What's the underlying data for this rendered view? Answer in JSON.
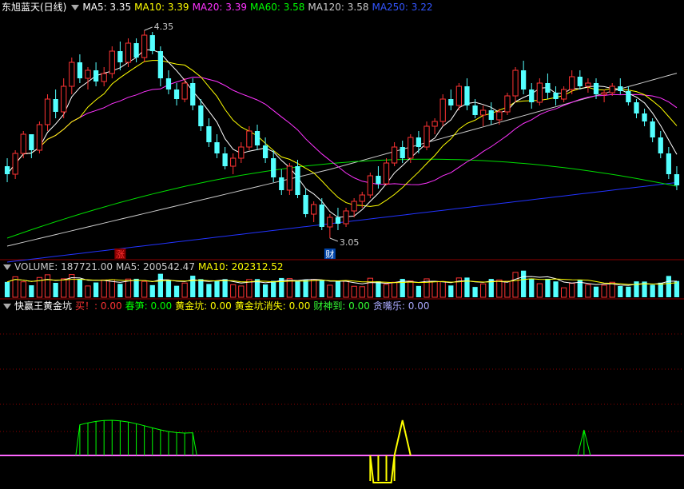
{
  "main_header": {
    "stock": "东旭蓝天(日线)",
    "ma_items": [
      {
        "label": "MA5: 3.35",
        "color": "#ffffff"
      },
      {
        "label": "MA10: 3.39",
        "color": "#ffff00"
      },
      {
        "label": "MA20: 3.39",
        "color": "#ff33ff"
      },
      {
        "label": "MA60: 3.58",
        "color": "#00ff00"
      },
      {
        "label": "MA120: 3.58",
        "color": "#cccccc"
      },
      {
        "label": "MA250: 3.22",
        "color": "#3355ff"
      }
    ]
  },
  "volume_header": {
    "items": [
      {
        "label": "VOLUME: 187721.00",
        "color": "#cccccc"
      },
      {
        "label": "MA5: 200542.47",
        "color": "#cccccc"
      },
      {
        "label": "MA10: 202312.52",
        "color": "#ffff00"
      }
    ]
  },
  "indicator_header": {
    "name": "快赢王黄金坑",
    "items": [
      {
        "label": "买！: 0.00",
        "color": "#ff3333"
      },
      {
        "label": "春笋: 0.00",
        "color": "#00ff00"
      },
      {
        "label": "黄金坑: 0.00",
        "color": "#ffff00"
      },
      {
        "label": "黄金坑消失: 0.00",
        "color": "#ffff00"
      },
      {
        "label": "财神到: 0.00",
        "color": "#33ff33"
      },
      {
        "label": "贪嘴乐: 0.00",
        "color": "#aaaaff"
      }
    ]
  },
  "markers": {
    "high": "4.35",
    "low": "3.05",
    "zhang": "涨",
    "cai": "财"
  },
  "colors": {
    "up": "#ff3333",
    "down": "#54ffff",
    "ma5": "#ffffff",
    "ma10": "#ffff00",
    "ma20": "#ff33ff",
    "ma60": "#00dd00",
    "ma120": "#cccccc",
    "ma250": "#2233ff",
    "grid": "#8b0000"
  },
  "chart_data": {
    "type": "candlestick",
    "ylim": [
      2.95,
      4.45
    ],
    "candles": [
      [
        3.5,
        3.55,
        3.4,
        3.45
      ],
      [
        3.45,
        3.6,
        3.42,
        3.58
      ],
      [
        3.58,
        3.72,
        3.55,
        3.7
      ],
      [
        3.7,
        3.7,
        3.55,
        3.6
      ],
      [
        3.6,
        3.78,
        3.58,
        3.76
      ],
      [
        3.76,
        3.95,
        3.72,
        3.92
      ],
      [
        3.92,
        3.98,
        3.8,
        3.84
      ],
      [
        3.84,
        4.05,
        3.8,
        4.0
      ],
      [
        4.0,
        4.18,
        3.95,
        4.15
      ],
      [
        4.15,
        4.2,
        4.02,
        4.05
      ],
      [
        4.05,
        4.12,
        3.98,
        4.1
      ],
      [
        4.1,
        4.15,
        4.0,
        4.03
      ],
      [
        4.03,
        4.12,
        4.0,
        4.08
      ],
      [
        4.08,
        4.25,
        4.05,
        4.22
      ],
      [
        4.22,
        4.28,
        4.1,
        4.15
      ],
      [
        4.15,
        4.3,
        4.12,
        4.27
      ],
      [
        4.27,
        4.3,
        4.15,
        4.18
      ],
      [
        4.18,
        4.35,
        4.15,
        4.32
      ],
      [
        4.32,
        4.34,
        4.2,
        4.22
      ],
      [
        4.22,
        4.25,
        4.0,
        4.05
      ],
      [
        4.05,
        4.1,
        3.95,
        3.98
      ],
      [
        3.98,
        4.02,
        3.88,
        3.92
      ],
      [
        3.92,
        4.05,
        3.9,
        4.02
      ],
      [
        4.02,
        4.05,
        3.85,
        3.88
      ],
      [
        3.88,
        3.92,
        3.72,
        3.75
      ],
      [
        3.75,
        3.8,
        3.62,
        3.65
      ],
      [
        3.65,
        3.7,
        3.55,
        3.58
      ],
      [
        3.58,
        3.62,
        3.48,
        3.5
      ],
      [
        3.5,
        3.58,
        3.45,
        3.55
      ],
      [
        3.55,
        3.65,
        3.52,
        3.62
      ],
      [
        3.62,
        3.75,
        3.6,
        3.72
      ],
      [
        3.72,
        3.76,
        3.6,
        3.63
      ],
      [
        3.63,
        3.68,
        3.52,
        3.55
      ],
      [
        3.55,
        3.6,
        3.4,
        3.43
      ],
      [
        3.43,
        3.48,
        3.32,
        3.35
      ],
      [
        3.35,
        3.52,
        3.32,
        3.5
      ],
      [
        3.5,
        3.54,
        3.3,
        3.32
      ],
      [
        3.32,
        3.36,
        3.18,
        3.2
      ],
      [
        3.2,
        3.28,
        3.15,
        3.26
      ],
      [
        3.26,
        3.3,
        3.1,
        3.12
      ],
      [
        3.12,
        3.2,
        3.05,
        3.18
      ],
      [
        3.18,
        3.24,
        3.1,
        3.14
      ],
      [
        3.14,
        3.24,
        3.12,
        3.22
      ],
      [
        3.22,
        3.3,
        3.18,
        3.28
      ],
      [
        3.28,
        3.34,
        3.24,
        3.32
      ],
      [
        3.32,
        3.46,
        3.3,
        3.44
      ],
      [
        3.44,
        3.5,
        3.36,
        3.39
      ],
      [
        3.39,
        3.55,
        3.38,
        3.52
      ],
      [
        3.52,
        3.65,
        3.5,
        3.62
      ],
      [
        3.62,
        3.66,
        3.52,
        3.55
      ],
      [
        3.55,
        3.7,
        3.52,
        3.68
      ],
      [
        3.68,
        3.72,
        3.58,
        3.62
      ],
      [
        3.62,
        3.78,
        3.6,
        3.75
      ],
      [
        3.75,
        3.8,
        3.7,
        3.78
      ],
      [
        3.78,
        3.95,
        3.75,
        3.92
      ],
      [
        3.92,
        3.98,
        3.85,
        3.88
      ],
      [
        3.88,
        4.02,
        3.85,
        4.0
      ],
      [
        4.0,
        4.05,
        3.85,
        3.88
      ],
      [
        3.88,
        3.92,
        3.8,
        3.82
      ],
      [
        3.82,
        3.88,
        3.75,
        3.85
      ],
      [
        3.85,
        3.9,
        3.76,
        3.79
      ],
      [
        3.79,
        3.86,
        3.76,
        3.84
      ],
      [
        3.84,
        3.96,
        3.82,
        3.94
      ],
      [
        3.94,
        4.12,
        3.9,
        4.1
      ],
      [
        4.1,
        4.16,
        3.95,
        3.98
      ],
      [
        3.98,
        4.02,
        3.86,
        3.9
      ],
      [
        3.9,
        4.05,
        3.88,
        4.02
      ],
      [
        4.02,
        4.08,
        3.92,
        3.96
      ],
      [
        3.96,
        4.0,
        3.88,
        3.92
      ],
      [
        3.92,
        4.0,
        3.9,
        3.98
      ],
      [
        3.98,
        4.1,
        3.95,
        4.06
      ],
      [
        4.06,
        4.1,
        3.98,
        4.0
      ],
      [
        4.0,
        4.05,
        3.96,
        4.02
      ],
      [
        4.02,
        4.05,
        3.92,
        3.95
      ],
      [
        3.95,
        3.98,
        3.9,
        3.96
      ],
      [
        3.96,
        4.02,
        3.94,
        4.0
      ],
      [
        4.0,
        4.05,
        3.95,
        3.97
      ],
      [
        3.97,
        4.0,
        3.88,
        3.9
      ],
      [
        3.9,
        3.92,
        3.8,
        3.83
      ],
      [
        3.83,
        3.86,
        3.75,
        3.78
      ],
      [
        3.78,
        3.8,
        3.65,
        3.68
      ],
      [
        3.68,
        3.72,
        3.55,
        3.58
      ],
      [
        3.58,
        3.62,
        3.42,
        3.45
      ],
      [
        3.45,
        3.5,
        3.35,
        3.38
      ]
    ],
    "volume_ylim": [
      0,
      400000
    ],
    "indicator": {
      "green_spans": [
        [
          9,
          23
        ]
      ],
      "yellow_dip": [
        [
          45,
          48
        ]
      ],
      "yellow_spike": [
        [
          48,
          50
        ]
      ],
      "green_spike": [
        [
          71,
          72
        ]
      ]
    }
  }
}
